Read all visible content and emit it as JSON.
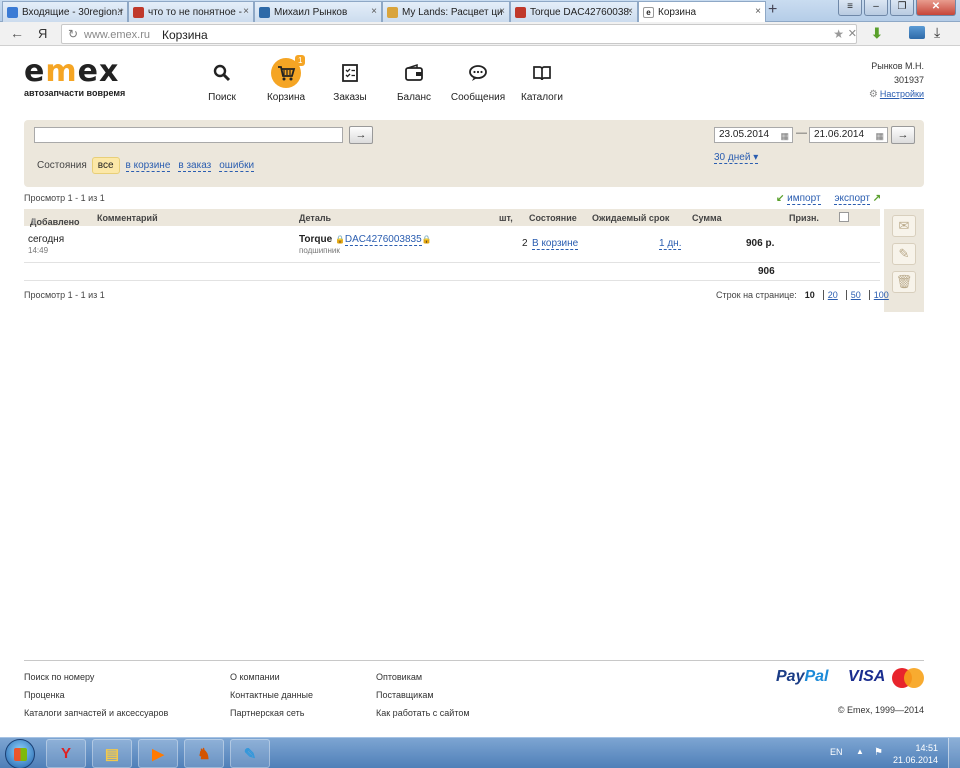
{
  "browser": {
    "tabs": [
      {
        "title": "Входящие - 30region.r",
        "icon_color": "#3a7bd5"
      },
      {
        "title": "что то не понятное - ",
        "icon_color": "#c0392b"
      },
      {
        "title": "Михаил Рынков",
        "icon_color": "#2e6aa8"
      },
      {
        "title": "My Lands: Расцвет ци",
        "icon_color": "#d9a43c"
      },
      {
        "title": "Torque DAC42760038:",
        "icon_color": "#c0392b"
      },
      {
        "title": "Корзина",
        "icon_color": "#ffffff"
      }
    ],
    "active_tab_icon_letter": "e",
    "yandex_label": "Я",
    "url_domain": "www.emex.ru",
    "page_title": "Корзина"
  },
  "site": {
    "logo_left": "e",
    "logo_mid": "m",
    "logo_right": "ex",
    "slogan": "автозапчасти вовремя",
    "nav": [
      {
        "label": "Поиск",
        "icon": "search-icon"
      },
      {
        "label": "Корзина",
        "icon": "cart-icon",
        "badge": "1"
      },
      {
        "label": "Заказы",
        "icon": "checklist-icon"
      },
      {
        "label": "Баланс",
        "icon": "wallet-icon"
      },
      {
        "label": "Сообщения",
        "icon": "chat-icon"
      },
      {
        "label": "Каталоги",
        "icon": "book-icon"
      }
    ],
    "user": {
      "name": "Рынков М.Н.",
      "id": "301937",
      "settings": "Настройки"
    }
  },
  "filter": {
    "search_value": "",
    "go_label": "→",
    "statuses_label": "Состояния",
    "status_all": "все",
    "status_in_cart": "в корзине",
    "status_to_order": "в заказ",
    "status_errors": "ошибки",
    "date_from": "23.05.2014",
    "date_sep": "—",
    "date_to": "21.06.2014",
    "period": "30 дней"
  },
  "table": {
    "pager_text": "Просмотр 1 - 1 из 1",
    "import": "импорт",
    "export": "экспорт",
    "headers": {
      "added": "Добавлено",
      "comment": "Комментарий",
      "detail": "Деталь",
      "qty": "шт,",
      "status": "Состояние",
      "expected": "Ожидаемый срок",
      "sum": "Сумма",
      "sign": "Призн."
    },
    "rows": [
      {
        "added_date": "сегодня",
        "added_time": "14:49",
        "brand": "Torque",
        "part_number": "DAC4276003835",
        "part_desc": "подшипник",
        "qty": "2",
        "status": "В корзине",
        "expected": "1 дн.",
        "sum": "906 р."
      }
    ],
    "total": "906",
    "rows_per_page_label": "Строк на странице:",
    "rows_per_page_options": [
      "10",
      "20",
      "50",
      "100"
    ]
  },
  "footer": {
    "col1": [
      "Поиск по номеру",
      "Проценка",
      "Каталоги запчастей и аксессуаров"
    ],
    "col2": [
      "О компании",
      "Контактные данные",
      "Партнерская сеть"
    ],
    "col3": [
      "Оптовикам",
      "Поставщикам",
      "Как работать с сайтом"
    ],
    "paypal_a": "Pay",
    "paypal_b": "Pal",
    "visa": "VISA",
    "mastercard": "MasterCard",
    "copyright": "© Emex, 1999—2014"
  },
  "taskbar": {
    "lang": "EN",
    "time": "14:51",
    "date": "21.06.2014"
  }
}
